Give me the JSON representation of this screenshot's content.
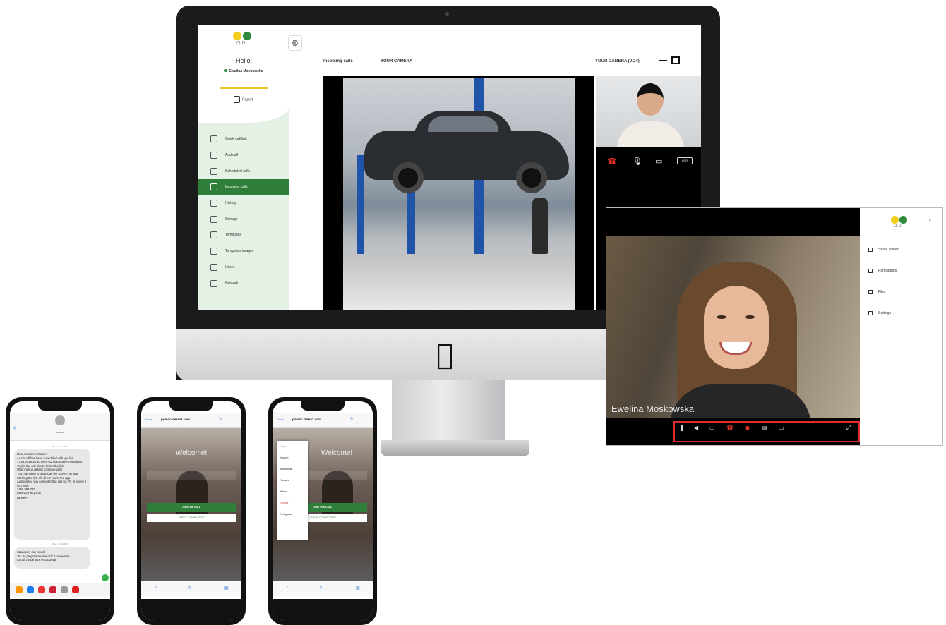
{
  "desktop": {
    "sidebar": {
      "logo_text": "Ɑ·D",
      "greeting": "Hello!",
      "user_name": "Ewelina Moskowska",
      "report_label": "Report",
      "gear_label": "Info",
      "items": [
        {
          "label": "Quick call link",
          "icon": "phone-link-icon"
        },
        {
          "label": "Add call",
          "icon": "phone-plus-icon"
        },
        {
          "label": "Scheduled calls",
          "icon": "calendar-icon"
        },
        {
          "label": "Incoming calls",
          "icon": "phone-incoming-icon"
        },
        {
          "label": "History",
          "icon": "clock-icon"
        },
        {
          "label": "Storage",
          "icon": "storage-icon"
        },
        {
          "label": "Templates",
          "icon": "template-icon"
        },
        {
          "label": "Templates images",
          "icon": "images-icon"
        },
        {
          "label": "Users",
          "icon": "users-icon"
        },
        {
          "label": "Network",
          "icon": "network-icon"
        }
      ],
      "active_index": 3
    },
    "tabs": {
      "active": "Incoming calls",
      "camera": "YOUR CAMERA",
      "timer": "YOUR CAMERA (0:24)"
    },
    "self_view_controls": {
      "hangup": "☎",
      "mic": "🎙",
      "camera": "▭",
      "more": "HDR"
    }
  },
  "tablet": {
    "participant_name": "Ewelina Moskowska",
    "logo_text": "Ɑ·D",
    "chevron": "›",
    "side_menu": [
      "Share screen",
      "Participants",
      "Files",
      "Settings"
    ],
    "toolbar": [
      "❚",
      "◀",
      "▭",
      "☎",
      "●",
      "▤",
      "▭",
      "⤢"
    ]
  },
  "phones": {
    "sms": {
      "contact": "DEKRA",
      "date_1": "Wed, 4 Jul 2018",
      "message_1": "Dear Customer Name!\nAn ID call has been scheduled with you for 17.04.2018 16:30 GMT+02:00Europe/Amsterdam.\nTo join the call please follow the link: https://a.hub.dekra2.com/join-xa2b\nYou may need to download the DEKRA ID app. Clicking the link will direct you to the app.\nAdditionally, you can enter this call via PC or phone if you wish.\n2456 893 737\nWith kind Regards,\nDEKRA",
      "date_2": "Wed, 4 Jul 2018",
      "message_2": "Szanowny Jan Kowal\nTel: 0o programowanie roz/ Szanowanie\nID call został prze 07.04.2018"
    },
    "browser": {
      "done": "Done",
      "url": "pomoc.dekra2.com",
      "welcome": "Welcome!",
      "join": "JOIN THE CALL",
      "check": "CHECK CONNECTION"
    },
    "languages": [
      "English",
      "Deutsch",
      "Nederlands",
      "Français",
      "Italiano",
      "Español",
      "Portuguese"
    ]
  }
}
